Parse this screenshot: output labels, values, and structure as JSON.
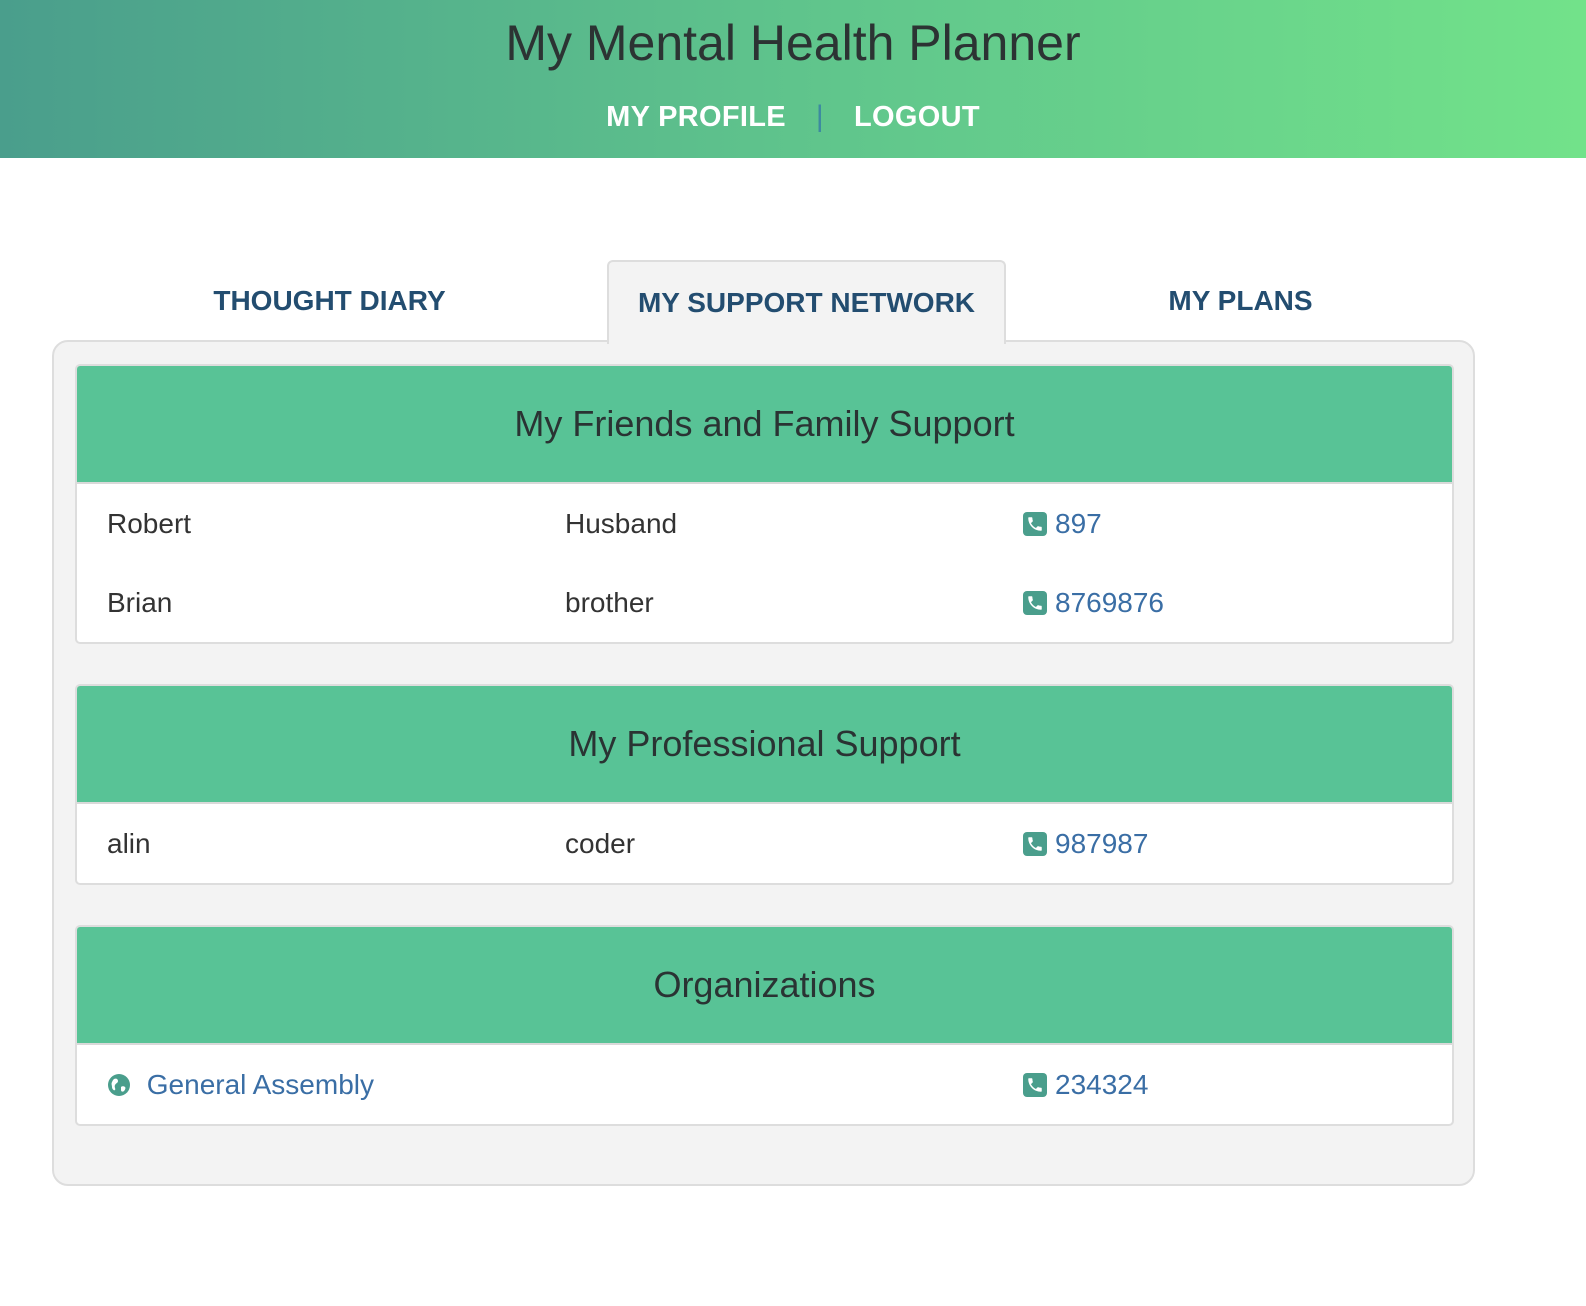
{
  "header": {
    "title": "My Mental Health Planner",
    "nav": {
      "profile": "MY PROFILE",
      "separator": "|",
      "logout": "LOGOUT"
    }
  },
  "tabs": [
    {
      "label": "THOUGHT DIARY",
      "active": false
    },
    {
      "label": "MY SUPPORT NETWORK",
      "active": true
    },
    {
      "label": "MY PLANS",
      "active": false
    }
  ],
  "friends": {
    "title": "My Friends and Family Support",
    "rows": [
      {
        "name": "Robert",
        "relation": "Husband",
        "phone": "897"
      },
      {
        "name": "Brian",
        "relation": "brother",
        "phone": "8769876"
      }
    ]
  },
  "professional": {
    "title": "My Professional Support",
    "rows": [
      {
        "name": "alin",
        "relation": "coder",
        "phone": "987987"
      }
    ]
  },
  "organizations": {
    "title": "Organizations",
    "rows": [
      {
        "name": "General Assembly",
        "phone": "234324"
      }
    ]
  },
  "colors": {
    "header_gradient_start": "#4a9e8c",
    "header_gradient_end": "#72e28a",
    "card_header": "#58c396",
    "tab_text": "#234d70",
    "link": "#3a6ea5",
    "icon": "#4a9e8c"
  }
}
